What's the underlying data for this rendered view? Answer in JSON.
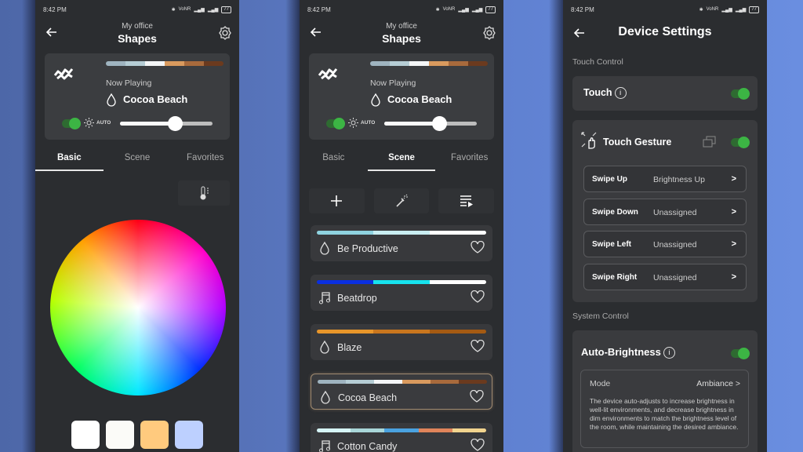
{
  "status_bar": {
    "time": "8:42 PM",
    "network": "VoNR",
    "battery": "77"
  },
  "colors": {
    "accent_green": "#3cb544",
    "background": "#2b2d30",
    "card": "#3b3d40"
  },
  "screen1": {
    "header": {
      "subtitle": "My office",
      "title": "Shapes"
    },
    "now_playing": {
      "label": "Now Playing",
      "scene": "Cocoa Beach",
      "palette": [
        "#9fb4c0",
        "#b6cdd5",
        "#f4f6f7",
        "#d99a5e",
        "#a86a3c",
        "#6b3a1e"
      ],
      "power_on": true,
      "auto_label": "AUTO",
      "brightness_percent": 59
    },
    "tabs": [
      {
        "label": "Basic",
        "active": true
      },
      {
        "label": "Scene",
        "active": false
      },
      {
        "label": "Favorites",
        "active": false
      }
    ],
    "color_temp_button": "thermometer-icon",
    "swatches": [
      "#ffffff",
      "#fbfbf8",
      "#ffca7e",
      "#bdd0ff"
    ]
  },
  "screen2": {
    "header": {
      "subtitle": "My office",
      "title": "Shapes"
    },
    "now_playing": {
      "label": "Now Playing",
      "scene": "Cocoa Beach",
      "palette": [
        "#9fb4c0",
        "#b6cdd5",
        "#f4f6f7",
        "#d99a5e",
        "#a86a3c",
        "#6b3a1e"
      ],
      "power_on": true,
      "auto_label": "AUTO",
      "brightness_percent": 59
    },
    "tabs": [
      {
        "label": "Basic",
        "active": false
      },
      {
        "label": "Scene",
        "active": true
      },
      {
        "label": "Favorites",
        "active": false
      }
    ],
    "actions": [
      "plus-icon",
      "magic-wand-icon",
      "playlist-play-icon"
    ],
    "scenes": [
      {
        "name": "Be Productive",
        "icon": "drop-icon",
        "palette": [
          "#8fd3e0",
          "#c9eef2",
          "#ffffff"
        ],
        "selected": false
      },
      {
        "name": "Beatdrop",
        "icon": "music-note-icon",
        "palette": [
          "#0a2fe0",
          "#17e3ee",
          "#ffffff"
        ],
        "selected": false
      },
      {
        "name": "Blaze",
        "icon": "drop-icon",
        "palette": [
          "#e8962a",
          "#c9761e",
          "#a55a12"
        ],
        "selected": false
      },
      {
        "name": "Cocoa Beach",
        "icon": "drop-icon",
        "palette": [
          "#9fb4c0",
          "#b6cdd5",
          "#f4f6f7",
          "#d99a5e",
          "#a86a3c",
          "#6b3a1e"
        ],
        "selected": true
      },
      {
        "name": "Cotton Candy",
        "icon": "music-note-icon",
        "palette": [
          "#d6f5f7",
          "#a9d6d8",
          "#4aa2e0",
          "#e0845a",
          "#f2d48e"
        ],
        "selected": false
      }
    ]
  },
  "screen3": {
    "title": "Device Settings",
    "touch_control_label": "Touch Control",
    "touch": {
      "label": "Touch",
      "on": true
    },
    "touch_gesture": {
      "label": "Touch Gesture",
      "on": true,
      "gestures": [
        {
          "key": "Swipe Up",
          "value": "Brightness Up"
        },
        {
          "key": "Swipe Down",
          "value": "Unassigned"
        },
        {
          "key": "Swipe Left",
          "value": "Unassigned"
        },
        {
          "key": "Swipe Right",
          "value": "Unassigned"
        }
      ],
      "chevron": ">"
    },
    "system_control_label": "System Control",
    "auto_brightness": {
      "label": "Auto-Brightness",
      "on": true,
      "mode_label": "Mode",
      "mode_value": "Ambiance >",
      "description": "The device auto-adjusts to increase brightness in well-lit environments, and decrease brightness in dim environments to match the brightness level of the room, while maintaining the desired ambiance."
    },
    "info_glyph": "i"
  }
}
